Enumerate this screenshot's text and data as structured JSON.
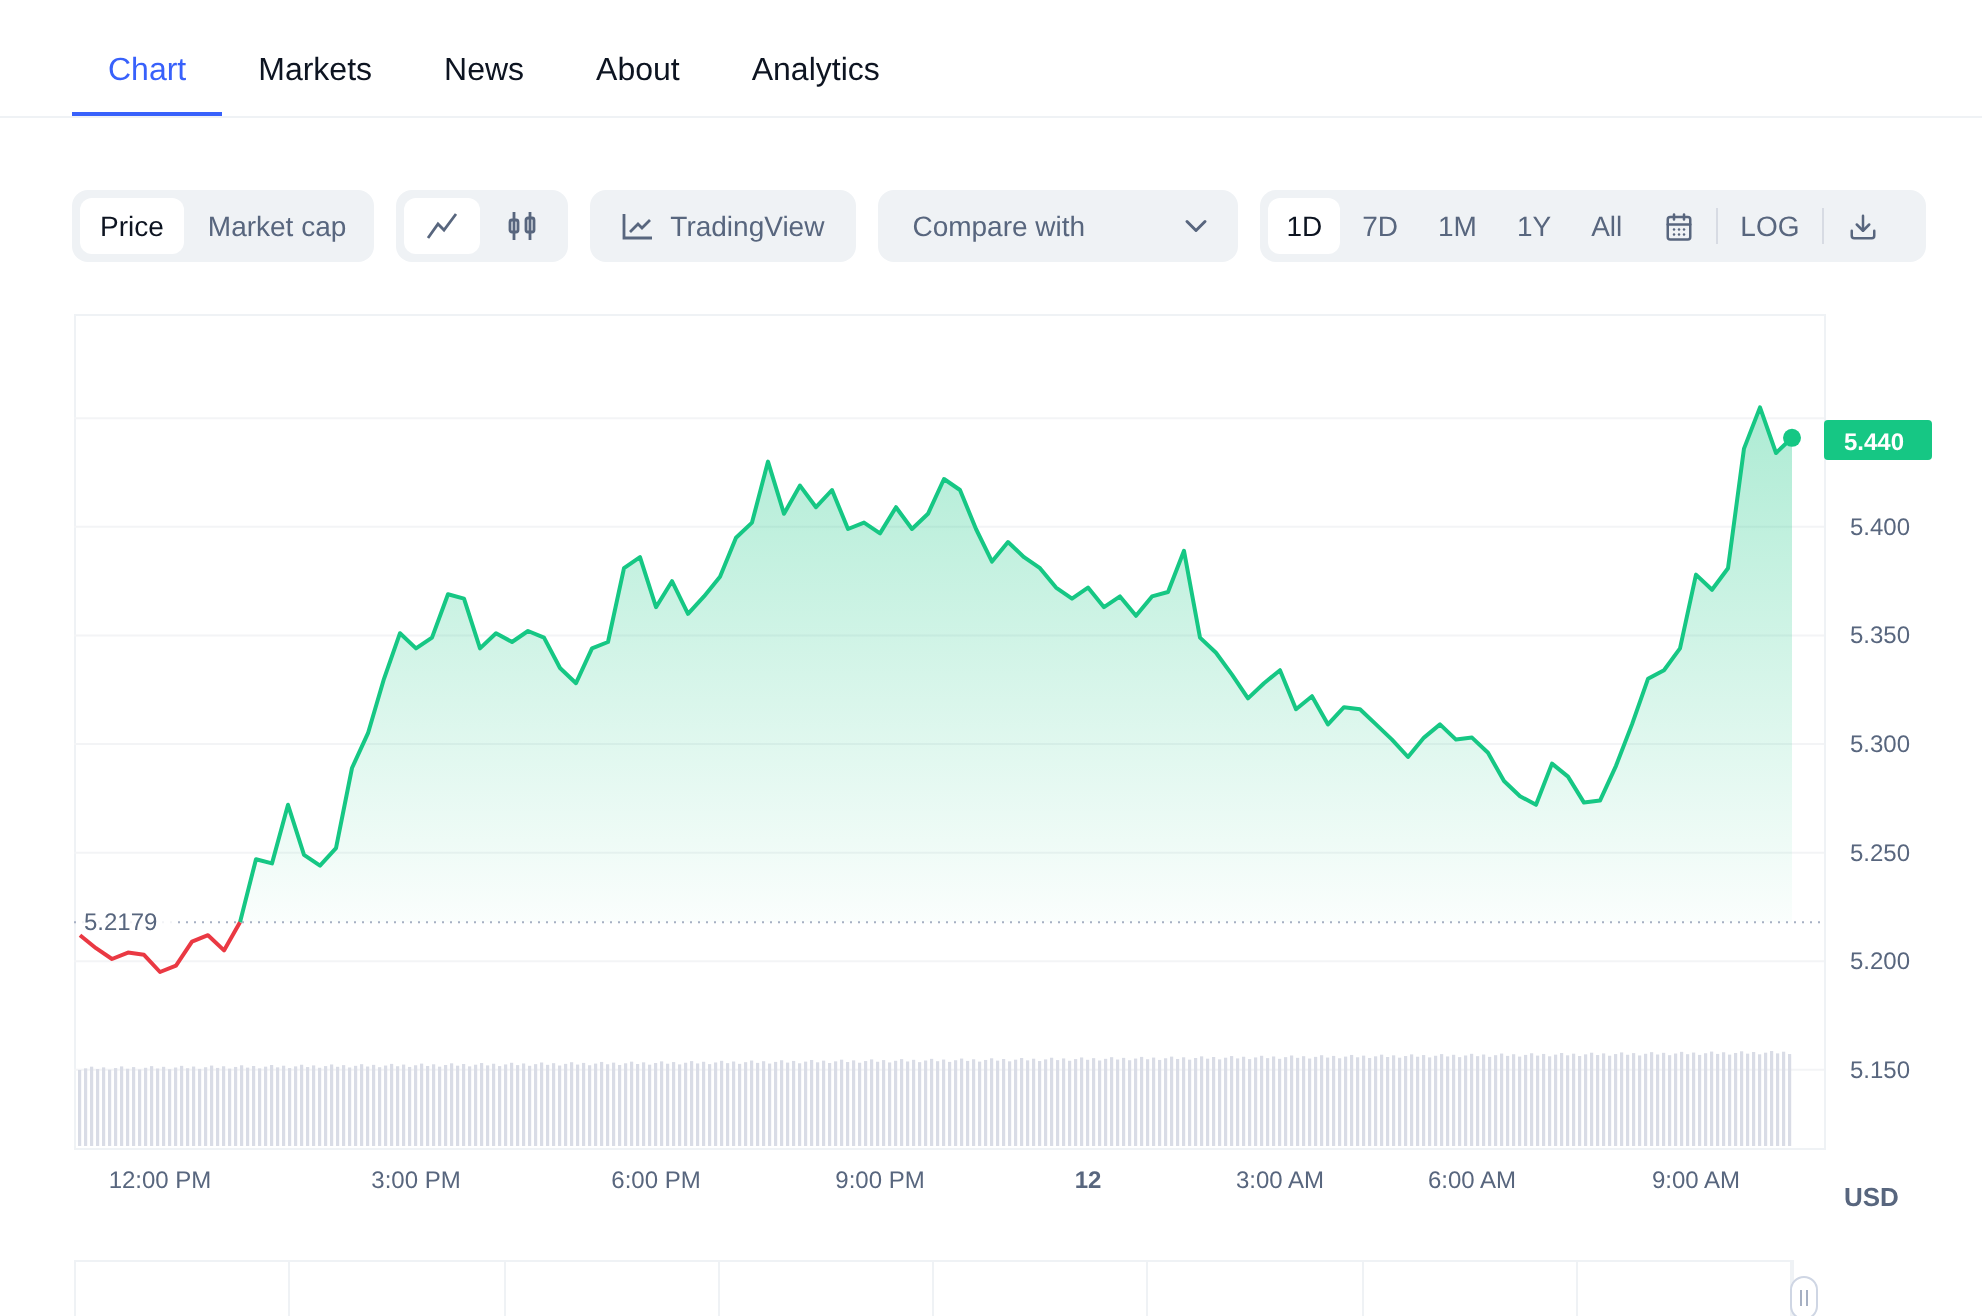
{
  "tabs": [
    {
      "label": "Chart",
      "selected": true
    },
    {
      "label": "Markets",
      "selected": false
    },
    {
      "label": "News",
      "selected": false
    },
    {
      "label": "About",
      "selected": false
    },
    {
      "label": "Analytics",
      "selected": false
    }
  ],
  "toolbar": {
    "price_modes": [
      {
        "label": "Price",
        "selected": true
      },
      {
        "label": "Market cap",
        "selected": false
      }
    ],
    "chart_types": [
      {
        "kind": "line",
        "selected": true
      },
      {
        "kind": "candle",
        "selected": false
      }
    ],
    "tradingview": "TradingView",
    "compare": "Compare with",
    "ranges": [
      {
        "label": "1D",
        "selected": true
      },
      {
        "label": "7D",
        "selected": false
      },
      {
        "label": "1M",
        "selected": false
      },
      {
        "label": "1Y",
        "selected": false
      },
      {
        "label": "All",
        "selected": false
      }
    ],
    "log": "LOG"
  },
  "chart": {
    "current_price": "5.440",
    "unit": "USD",
    "chart_data": {
      "type": "area",
      "grid": true,
      "ref_lines": [
        {
          "axis": "y",
          "value": 5.2179,
          "label": "5.2179"
        }
      ],
      "ylim": [
        5.114,
        5.498
      ],
      "categories": [
        null,
        null,
        null,
        null,
        null,
        "12:00 PM",
        null,
        null,
        null,
        null,
        null,
        null,
        null,
        null,
        null,
        null,
        null,
        null,
        null,
        null,
        null,
        "3:00 PM",
        null,
        null,
        null,
        null,
        null,
        null,
        null,
        null,
        null,
        null,
        null,
        null,
        null,
        null,
        "6:00 PM",
        null,
        null,
        null,
        null,
        null,
        null,
        null,
        null,
        null,
        null,
        null,
        null,
        null,
        "9:00 PM",
        null,
        null,
        null,
        null,
        null,
        null,
        null,
        null,
        null,
        null,
        null,
        null,
        "12",
        null,
        null,
        null,
        null,
        null,
        null,
        null,
        null,
        null,
        null,
        null,
        "3:00 AM",
        null,
        null,
        null,
        null,
        null,
        null,
        null,
        null,
        null,
        null,
        null,
        "6:00 AM",
        null,
        null,
        null,
        null,
        null,
        null,
        null,
        null,
        null,
        null,
        null,
        null,
        null,
        "9:00 AM",
        null,
        null,
        null,
        null,
        null,
        null
      ],
      "yticks": [
        {
          "value": 5.15,
          "label": "5.150"
        },
        {
          "value": 5.2,
          "label": "5.200"
        },
        {
          "value": 5.25,
          "label": "5.250"
        },
        {
          "value": 5.3,
          "label": "5.300"
        },
        {
          "value": 5.35,
          "label": "5.350"
        },
        {
          "value": 5.4,
          "label": "5.400"
        }
      ],
      "series": [
        {
          "color": "#16c784",
          "type": "area",
          "values": [
            null,
            null,
            null,
            null,
            null,
            null,
            null,
            null,
            null,
            null,
            5.218,
            5.247,
            5.245,
            5.272,
            5.249,
            5.244,
            5.252,
            5.289,
            5.305,
            5.33,
            5.351,
            5.344,
            5.349,
            5.369,
            5.367,
            5.344,
            5.351,
            5.347,
            5.352,
            5.349,
            5.335,
            5.328,
            5.344,
            5.347,
            5.381,
            5.386,
            5.363,
            5.375,
            5.36,
            5.368,
            5.377,
            5.395,
            5.402,
            5.43,
            5.406,
            5.419,
            5.409,
            5.417,
            5.399,
            5.402,
            5.397,
            5.409,
            5.399,
            5.406,
            5.422,
            5.417,
            5.399,
            5.384,
            5.393,
            5.386,
            5.381,
            5.372,
            5.367,
            5.372,
            5.363,
            5.368,
            5.359,
            5.368,
            5.37,
            5.389,
            5.349,
            5.342,
            5.332,
            5.321,
            5.328,
            5.334,
            5.316,
            5.322,
            5.309,
            5.317,
            5.316,
            5.309,
            5.302,
            5.294,
            5.303,
            5.309,
            5.302,
            5.303,
            5.296,
            5.283,
            5.276,
            5.272,
            5.291,
            5.285,
            5.273,
            5.274,
            5.29,
            5.309,
            5.33,
            5.334,
            5.344,
            5.378,
            5.371,
            5.381,
            5.436,
            5.455,
            5.434,
            5.441
          ]
        },
        {
          "color": "#ea3943",
          "type": "line",
          "values": [
            5.212,
            5.206,
            5.201,
            5.204,
            5.203,
            5.195,
            5.198,
            5.209,
            5.212,
            5.205,
            5.218,
            null,
            null,
            null,
            null,
            null,
            null,
            null,
            null,
            null,
            null,
            null,
            null,
            null,
            null,
            null,
            null,
            null,
            null,
            null,
            null,
            null,
            null,
            null,
            null,
            null,
            null,
            null,
            null,
            null,
            null,
            null,
            null,
            null,
            null,
            null,
            null,
            null,
            null,
            null,
            null,
            null,
            null,
            null,
            null,
            null,
            null,
            null,
            null,
            null,
            null,
            null,
            null,
            null,
            null,
            null,
            null,
            null,
            null,
            null,
            null,
            null,
            null,
            null,
            null,
            null,
            null,
            null,
            null,
            null,
            null,
            null,
            null,
            null,
            null,
            null,
            null,
            null,
            null,
            null,
            null,
            null,
            null,
            null,
            null,
            null,
            null,
            null,
            null,
            null,
            null,
            null,
            null,
            null,
            null,
            null,
            null,
            null
          ]
        }
      ]
    }
  }
}
